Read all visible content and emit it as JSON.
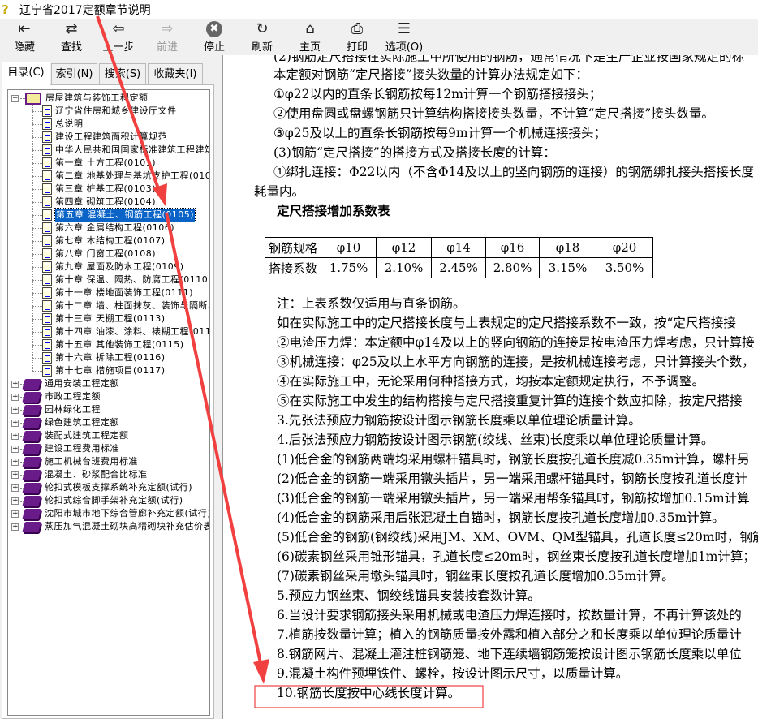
{
  "window": {
    "title": "辽宁省2017定额章节说明"
  },
  "toolbar": [
    {
      "label": "隐藏",
      "icon": "hide-icon",
      "glyph": "⇤"
    },
    {
      "label": "查找",
      "icon": "find-icon",
      "glyph": "⇄"
    },
    {
      "label": "上一步",
      "icon": "back-arrow-icon",
      "glyph": "⇦"
    },
    {
      "label": "前进",
      "icon": "forward-arrow-icon",
      "glyph": "⇨",
      "disabled": true
    },
    {
      "label": "停止",
      "icon": "stop-icon",
      "glyph": "✖"
    },
    {
      "label": "刷新",
      "icon": "refresh-icon",
      "glyph": "↻"
    },
    {
      "label": "主页",
      "icon": "home-icon",
      "glyph": "⌂"
    },
    {
      "label": "打印",
      "icon": "print-icon",
      "glyph": "⎙"
    },
    {
      "label": "选项(O)",
      "icon": "options-icon",
      "glyph": "☰"
    }
  ],
  "tabs": [
    {
      "label": "目录(C)",
      "active": true
    },
    {
      "label": "索引(N)"
    },
    {
      "label": "搜索(S)"
    },
    {
      "label": "收藏夹(I)"
    }
  ],
  "tree": {
    "root": "房屋建筑与装饰工程定额",
    "children": [
      "辽宁省住房和城乡建设厅文件",
      "总说明",
      "建设工程建筑面积计算规范",
      "中华人民共和国国家标准建筑工程建筑",
      "第一章  土方工程(0101)",
      "第二章  地基处理与基坑支护工程(0102)",
      "第三章  桩基工程(0103)",
      "第四章  砌筑工程(0104)",
      "第五章  混凝土、钢筋工程(0105)",
      "第六章  金属结构工程(0106)",
      "第七章  木结构工程(0107)",
      "第八章  门窗工程(0108)",
      "第九章  屋面及防水工程(0109)",
      "第十章  保温、隔热、防腐工程(0110)",
      "第十一章  楼地面装饰工程(0111)",
      "第十二章  墙、柱面抹灰、装饰与隔断、",
      "第十三章  天棚工程(0113)",
      "第十四章  油漆、涂料、裱糊工程(0114)",
      "第十五章  其他装饰工程(0115)",
      "第十六章  拆除工程(0116)",
      "第十七章  措施项目(0117)"
    ],
    "selected_index": 8,
    "books": [
      "通用安装工程定额",
      "市政工程定额",
      "园林绿化工程",
      "绿色建筑工程定额",
      "装配式建筑工程定额",
      "建设工程费用标准",
      "施工机械台班费用标准",
      "混凝土、砂浆配合比标准",
      "轮扣式模板支撑系统补充定额(试行)",
      "轮扣式综合脚手架补充定额(试行)",
      "沈阳市城市地下综合管廊补充定额(试行)",
      "蒸压加气混凝土砌块高精砌块补充估价表("
    ]
  },
  "content": {
    "lines_top": [
      "(2)钢筋定尺搭接在实际施工中所使用的钢筋，通常情况下是生产企业按国家规定的标",
      "本定额对钢筋“定尺搭接”接头数量的计算办法规定如下：",
      "①φ22以内的直条长钢筋按每12m计算一个钢筋搭接接头；",
      "②使用盘圆或盘螺钢筋只计算结构搭接接头数量，不计算“定尺搭接”接头数量。",
      "③φ25及以上的直条长钢筋按每9m计算一个机械连接接头；",
      "(3)钢筋“定尺搭接”的搭接方式及搭接长度的计算：",
      "①绑扎连接：Φ22以内（不含Φ14及以上的竖向钢筋的连接）的钢筋绑扎接头搭接长度",
      "耗量内。"
    ],
    "table_title": "定尺搭接增加系数表",
    "table": {
      "header": [
        "钢筋规格",
        "φ10",
        "φ12",
        "φ14",
        "φ16",
        "φ18",
        "φ20"
      ],
      "row": [
        "搭接系数",
        "1.75%",
        "2.10%",
        "2.45%",
        "2.80%",
        "3.15%",
        "3.50%"
      ]
    },
    "lines_bottom": [
      "注：上表系数仅适用与直条钢筋。",
      "如在实际施工中的定尺搭接长度与上表规定的定尺搭接系数不一致，按“定尺搭接接",
      "②电渣压力焊：本定额中φ14及以上的竖向钢筋的连接是按电渣压力焊考虑，只计算接",
      "③机械连接：φ25及以上水平方向钢筋的连接，是按机械连接考虑，只计算接头个数，",
      "④在实际施工中，无论采用何种搭接方式，均按本定额规定执行，不予调整。",
      "⑤在实际施工中发生的结构搭接与定尺搭接重复计算的连接个数应扣除，按定尺搭接",
      "3.先张法预应力钢筋按设计图示钢筋长度乘以单位理论质量计算。",
      "4.后张法预应力钢筋按设计图示钢筋(绞线、丝束)长度乘以单位理论质量计算。",
      "(1)低合金的钢筋两端均采用螺杆锚具时，钢筋长度按孔道长度减0.35m计算，螺杆另",
      "(2)低合金的钢筋一端采用镦头插片，另一端采用螺杆锚具时，钢筋长度按孔道长度计",
      "(3)低合金的钢筋一端采用镦头插片，另一端采用帮条锚具时，钢筋按增加0.15m计算",
      "(4)低合金的钢筋采用后张混凝土自锚时，钢筋长度按孔道长度增加0.35m计算。",
      "(5)低合金的钢筋(钢绞线)采用JM、XM、OVM、QM型锚具，孔道长度≤20m时，钢筋长度",
      "(6)碳素钢丝采用锥形锚具，孔道长度≤20m时，钢丝束长度按孔道长度增加1m计算；",
      "(7)碳素钢丝采用墩头锚具时，钢丝束长度按孔道长度增加0.35m计算。",
      "5.预应力钢丝束、钢绞线锚具安装按套数计算。",
      "6.当设计要求钢筋接头采用机械或电渣压力焊连接时，按数量计算，不再计算该处的",
      "7.植筋按数量计算；植入的钢筋质量按外露和植入部分之和长度乘以单位理论质量计",
      "8.钢筋网片、混凝土灌注桩钢筋笼、地下连续墙钢筋笼按设计图示钢筋长度乘以单位",
      "9.混凝土构件预埋铁件、螺栓，按设计图示尺寸，以质量计算。",
      "10.钢筋长度按中心线长度计算。"
    ]
  },
  "colors": {
    "selection": "#0a64c8",
    "annotation": "#f04040",
    "book": "#6a1b8a"
  }
}
